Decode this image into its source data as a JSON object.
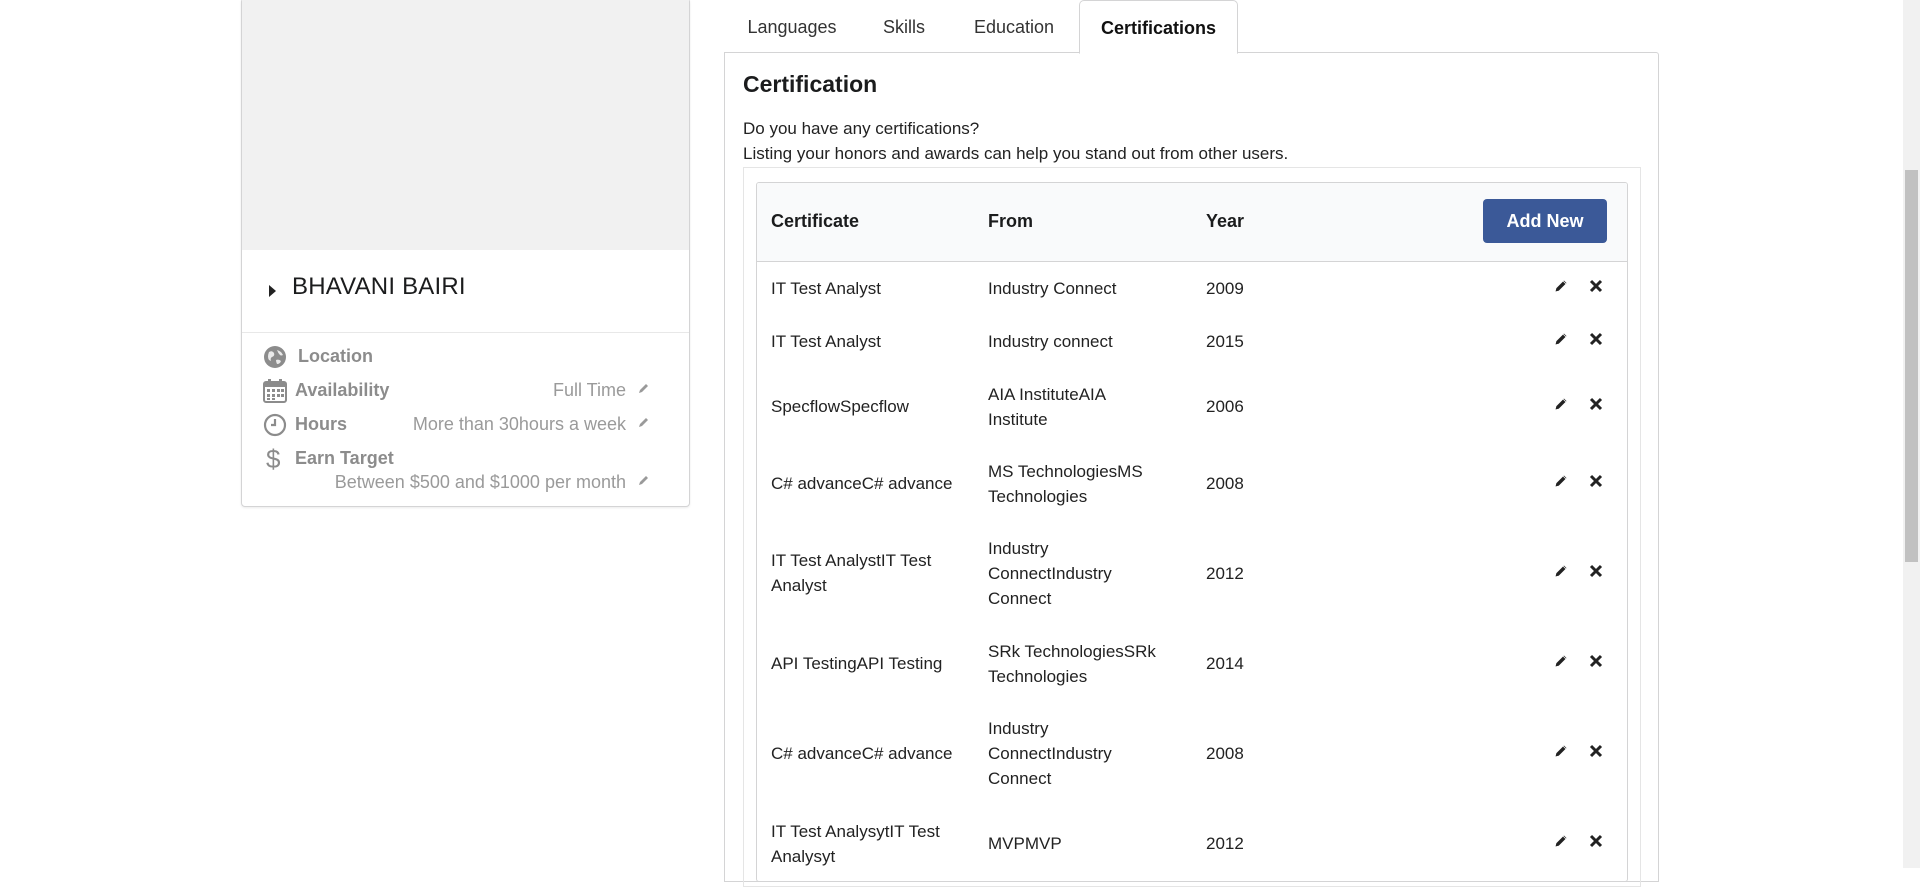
{
  "profile": {
    "name": "BHAVANI BAIRI",
    "location_label": "Location",
    "availability_label": "Availability",
    "availability_value": "Full Time",
    "hours_label": "Hours",
    "hours_value": "More than 30hours a week",
    "earn_label": "Earn Target",
    "earn_value": "Between $500 and $1000 per month"
  },
  "tabs": [
    {
      "label": "Languages"
    },
    {
      "label": "Skills"
    },
    {
      "label": "Education"
    },
    {
      "label": "Certifications"
    }
  ],
  "active_tab": "Certifications",
  "certification": {
    "title": "Certification",
    "question": "Do you have any certifications?",
    "hint": "Listing your honors and awards can help you stand out from other users.",
    "columns": {
      "certificate": "Certificate",
      "from": "From",
      "year": "Year"
    },
    "add_label": "Add New",
    "rows": [
      {
        "certificate": "IT Test Analyst",
        "from": "Industry Connect",
        "year": "2009"
      },
      {
        "certificate": "IT Test Analyst",
        "from": "Industry connect",
        "year": "2015"
      },
      {
        "certificate": "SpecflowSpecflow",
        "from": "AIA InstituteAIA Institute",
        "year": "2006"
      },
      {
        "certificate": "C# advanceC# advance",
        "from": "MS TechnologiesMS Technologies",
        "year": "2008"
      },
      {
        "certificate": "IT Test AnalystIT Test Analyst",
        "from": "Industry ConnectIndustry Connect",
        "year": "2012"
      },
      {
        "certificate": "API TestingAPI Testing",
        "from": "SRk TechnologiesSRk Technologies",
        "year": "2014"
      },
      {
        "certificate": "C# advanceC# advance",
        "from": "Industry ConnectIndustry Connect",
        "year": "2008"
      },
      {
        "certificate": "IT Test AnalysytIT Test Analysyt",
        "from": "MVPMVP",
        "year": "2012"
      }
    ]
  },
  "colors": {
    "accent": "#3b5998",
    "muted": "#8c8c8c",
    "border": "#d4d4d5"
  },
  "icons": {
    "location": "globe-icon",
    "availability": "calendar-icon",
    "hours": "clock-icon",
    "earn": "dollar-icon",
    "edit": "pencil-icon",
    "delete": "close-icon"
  }
}
